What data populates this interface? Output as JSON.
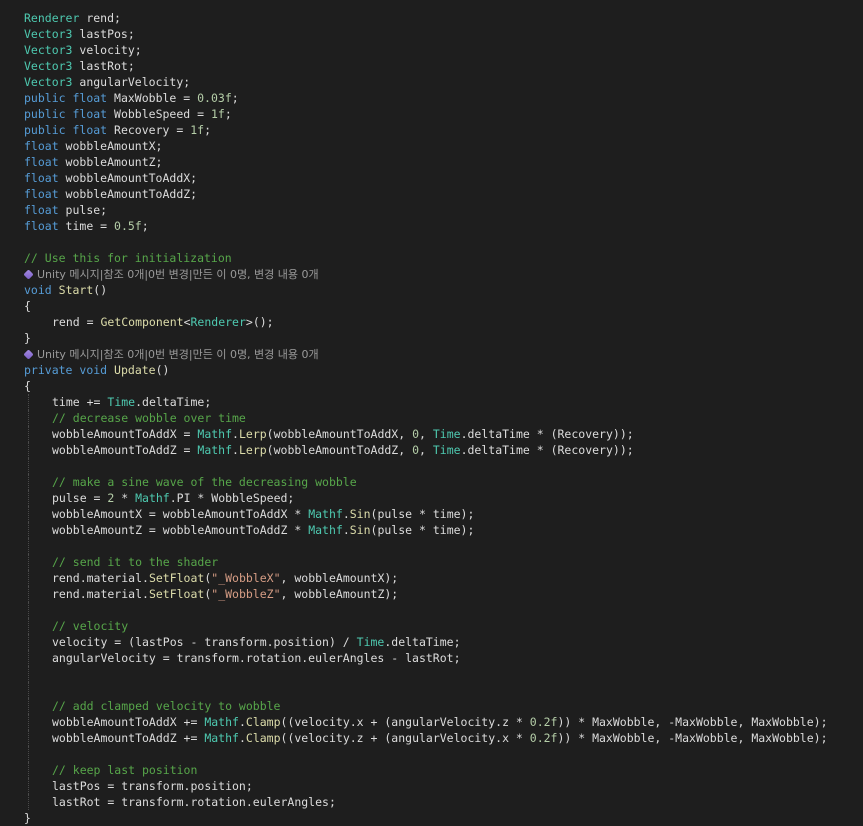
{
  "editor": {
    "lines": [
      {
        "indent": 0,
        "tokens": [
          {
            "t": "Renderer",
            "c": "ty"
          },
          {
            "t": " rend;",
            "c": "pl"
          }
        ]
      },
      {
        "indent": 0,
        "tokens": [
          {
            "t": "Vector3",
            "c": "ty"
          },
          {
            "t": " lastPos;",
            "c": "pl"
          }
        ]
      },
      {
        "indent": 0,
        "tokens": [
          {
            "t": "Vector3",
            "c": "ty"
          },
          {
            "t": " velocity;",
            "c": "pl"
          }
        ]
      },
      {
        "indent": 0,
        "tokens": [
          {
            "t": "Vector3",
            "c": "ty"
          },
          {
            "t": " lastRot;",
            "c": "pl"
          }
        ]
      },
      {
        "indent": 0,
        "tokens": [
          {
            "t": "Vector3",
            "c": "ty"
          },
          {
            "t": " angularVelocity;",
            "c": "pl"
          }
        ]
      },
      {
        "indent": 0,
        "tokens": [
          {
            "t": "public",
            "c": "kw"
          },
          {
            "t": " ",
            "c": "pl"
          },
          {
            "t": "float",
            "c": "kw"
          },
          {
            "t": " MaxWobble = ",
            "c": "pl"
          },
          {
            "t": "0.03f",
            "c": "nu"
          },
          {
            "t": ";",
            "c": "pl"
          }
        ]
      },
      {
        "indent": 0,
        "tokens": [
          {
            "t": "public",
            "c": "kw"
          },
          {
            "t": " ",
            "c": "pl"
          },
          {
            "t": "float",
            "c": "kw"
          },
          {
            "t": " WobbleSpeed = ",
            "c": "pl"
          },
          {
            "t": "1f",
            "c": "nu"
          },
          {
            "t": ";",
            "c": "pl"
          }
        ]
      },
      {
        "indent": 0,
        "tokens": [
          {
            "t": "public",
            "c": "kw"
          },
          {
            "t": " ",
            "c": "pl"
          },
          {
            "t": "float",
            "c": "kw"
          },
          {
            "t": " Recovery = ",
            "c": "pl"
          },
          {
            "t": "1f",
            "c": "nu"
          },
          {
            "t": ";",
            "c": "pl"
          }
        ]
      },
      {
        "indent": 0,
        "tokens": [
          {
            "t": "float",
            "c": "kw"
          },
          {
            "t": " wobbleAmountX;",
            "c": "pl"
          }
        ]
      },
      {
        "indent": 0,
        "tokens": [
          {
            "t": "float",
            "c": "kw"
          },
          {
            "t": " wobbleAmountZ;",
            "c": "pl"
          }
        ]
      },
      {
        "indent": 0,
        "tokens": [
          {
            "t": "float",
            "c": "kw"
          },
          {
            "t": " wobbleAmountToAddX;",
            "c": "pl"
          }
        ]
      },
      {
        "indent": 0,
        "tokens": [
          {
            "t": "float",
            "c": "kw"
          },
          {
            "t": " wobbleAmountToAddZ;",
            "c": "pl"
          }
        ]
      },
      {
        "indent": 0,
        "tokens": [
          {
            "t": "float",
            "c": "kw"
          },
          {
            "t": " pulse;",
            "c": "pl"
          }
        ]
      },
      {
        "indent": 0,
        "tokens": [
          {
            "t": "float",
            "c": "kw"
          },
          {
            "t": " time = ",
            "c": "pl"
          },
          {
            "t": "0.5f",
            "c": "nu"
          },
          {
            "t": ";",
            "c": "pl"
          }
        ]
      },
      {
        "indent": 0,
        "tokens": []
      },
      {
        "indent": 0,
        "tokens": [
          {
            "t": "// Use this for initialization",
            "c": "cm"
          }
        ]
      },
      {
        "indent": 0,
        "lens": "Unity 메시지|참조 0개|0번 변경|만든 이 0명, 변경 내용 0개"
      },
      {
        "indent": 0,
        "tokens": [
          {
            "t": "void",
            "c": "kw"
          },
          {
            "t": " ",
            "c": "pl"
          },
          {
            "t": "Start",
            "c": "fn"
          },
          {
            "t": "()",
            "c": "pl"
          }
        ]
      },
      {
        "indent": 0,
        "tokens": [
          {
            "t": "{",
            "c": "pl"
          }
        ]
      },
      {
        "indent": 1,
        "noguide": true,
        "tokens": [
          {
            "t": "rend = ",
            "c": "pl"
          },
          {
            "t": "GetComponent",
            "c": "fn"
          },
          {
            "t": "<",
            "c": "pl"
          },
          {
            "t": "Renderer",
            "c": "ty"
          },
          {
            "t": ">();",
            "c": "pl"
          }
        ]
      },
      {
        "indent": 0,
        "tokens": [
          {
            "t": "}",
            "c": "pl"
          }
        ]
      },
      {
        "indent": 0,
        "lens": "Unity 메시지|참조 0개|0번 변경|만든 이 0명, 변경 내용 0개"
      },
      {
        "indent": 0,
        "tokens": [
          {
            "t": "private",
            "c": "kw"
          },
          {
            "t": " ",
            "c": "pl"
          },
          {
            "t": "void",
            "c": "kw"
          },
          {
            "t": " ",
            "c": "pl"
          },
          {
            "t": "Update",
            "c": "fn"
          },
          {
            "t": "()",
            "c": "pl"
          }
        ]
      },
      {
        "indent": 0,
        "tokens": [
          {
            "t": "{",
            "c": "pl"
          }
        ]
      },
      {
        "indent": 1,
        "tokens": [
          {
            "t": "time += ",
            "c": "pl"
          },
          {
            "t": "Time",
            "c": "ty"
          },
          {
            "t": ".deltaTime;",
            "c": "pl"
          }
        ]
      },
      {
        "indent": 1,
        "tokens": [
          {
            "t": "// decrease wobble over time",
            "c": "cm"
          }
        ]
      },
      {
        "indent": 1,
        "tokens": [
          {
            "t": "wobbleAmountToAddX = ",
            "c": "pl"
          },
          {
            "t": "Mathf",
            "c": "ty"
          },
          {
            "t": ".",
            "c": "pl"
          },
          {
            "t": "Lerp",
            "c": "fn"
          },
          {
            "t": "(wobbleAmountToAddX, ",
            "c": "pl"
          },
          {
            "t": "0",
            "c": "nu"
          },
          {
            "t": ", ",
            "c": "pl"
          },
          {
            "t": "Time",
            "c": "ty"
          },
          {
            "t": ".deltaTime * (Recovery));",
            "c": "pl"
          }
        ]
      },
      {
        "indent": 1,
        "tokens": [
          {
            "t": "wobbleAmountToAddZ = ",
            "c": "pl"
          },
          {
            "t": "Mathf",
            "c": "ty"
          },
          {
            "t": ".",
            "c": "pl"
          },
          {
            "t": "Lerp",
            "c": "fn"
          },
          {
            "t": "(wobbleAmountToAddZ, ",
            "c": "pl"
          },
          {
            "t": "0",
            "c": "nu"
          },
          {
            "t": ", ",
            "c": "pl"
          },
          {
            "t": "Time",
            "c": "ty"
          },
          {
            "t": ".deltaTime * (Recovery));",
            "c": "pl"
          }
        ]
      },
      {
        "indent": 1,
        "tokens": []
      },
      {
        "indent": 1,
        "tokens": [
          {
            "t": "// make a sine wave of the decreasing wobble",
            "c": "cm"
          }
        ]
      },
      {
        "indent": 1,
        "tokens": [
          {
            "t": "pulse = ",
            "c": "pl"
          },
          {
            "t": "2",
            "c": "nu"
          },
          {
            "t": " * ",
            "c": "pl"
          },
          {
            "t": "Mathf",
            "c": "ty"
          },
          {
            "t": ".PI * WobbleSpeed;",
            "c": "pl"
          }
        ]
      },
      {
        "indent": 1,
        "tokens": [
          {
            "t": "wobbleAmountX = wobbleAmountToAddX * ",
            "c": "pl"
          },
          {
            "t": "Mathf",
            "c": "ty"
          },
          {
            "t": ".",
            "c": "pl"
          },
          {
            "t": "Sin",
            "c": "fn"
          },
          {
            "t": "(pulse * time);",
            "c": "pl"
          }
        ]
      },
      {
        "indent": 1,
        "tokens": [
          {
            "t": "wobbleAmountZ = wobbleAmountToAddZ * ",
            "c": "pl"
          },
          {
            "t": "Mathf",
            "c": "ty"
          },
          {
            "t": ".",
            "c": "pl"
          },
          {
            "t": "Sin",
            "c": "fn"
          },
          {
            "t": "(pulse * time);",
            "c": "pl"
          }
        ]
      },
      {
        "indent": 1,
        "tokens": []
      },
      {
        "indent": 1,
        "tokens": [
          {
            "t": "// send it to the shader",
            "c": "cm"
          }
        ]
      },
      {
        "indent": 1,
        "tokens": [
          {
            "t": "rend.material.",
            "c": "pl"
          },
          {
            "t": "SetFloat",
            "c": "fn"
          },
          {
            "t": "(",
            "c": "pl"
          },
          {
            "t": "\"_WobbleX\"",
            "c": "st"
          },
          {
            "t": ", wobbleAmountX);",
            "c": "pl"
          }
        ]
      },
      {
        "indent": 1,
        "tokens": [
          {
            "t": "rend.material.",
            "c": "pl"
          },
          {
            "t": "SetFloat",
            "c": "fn"
          },
          {
            "t": "(",
            "c": "pl"
          },
          {
            "t": "\"_WobbleZ\"",
            "c": "st"
          },
          {
            "t": ", wobbleAmountZ);",
            "c": "pl"
          }
        ]
      },
      {
        "indent": 1,
        "tokens": []
      },
      {
        "indent": 1,
        "tokens": [
          {
            "t": "// velocity",
            "c": "cm"
          }
        ]
      },
      {
        "indent": 1,
        "tokens": [
          {
            "t": "velocity = (lastPos - transform.position) / ",
            "c": "pl"
          },
          {
            "t": "Time",
            "c": "ty"
          },
          {
            "t": ".deltaTime;",
            "c": "pl"
          }
        ]
      },
      {
        "indent": 1,
        "tokens": [
          {
            "t": "angularVelocity = transform.rotation.eulerAngles - lastRot;",
            "c": "pl"
          }
        ]
      },
      {
        "indent": 1,
        "tokens": []
      },
      {
        "indent": 1,
        "tokens": []
      },
      {
        "indent": 1,
        "tokens": [
          {
            "t": "// add clamped velocity to wobble",
            "c": "cm"
          }
        ]
      },
      {
        "indent": 1,
        "tokens": [
          {
            "t": "wobbleAmountToAddX += ",
            "c": "pl"
          },
          {
            "t": "Mathf",
            "c": "ty"
          },
          {
            "t": ".",
            "c": "pl"
          },
          {
            "t": "Clamp",
            "c": "fn"
          },
          {
            "t": "((velocity.x + (angularVelocity.z * ",
            "c": "pl"
          },
          {
            "t": "0.2f",
            "c": "nu"
          },
          {
            "t": ")) * MaxWobble, -MaxWobble, MaxWobble);",
            "c": "pl"
          }
        ]
      },
      {
        "indent": 1,
        "tokens": [
          {
            "t": "wobbleAmountToAddZ += ",
            "c": "pl"
          },
          {
            "t": "Mathf",
            "c": "ty"
          },
          {
            "t": ".",
            "c": "pl"
          },
          {
            "t": "Clamp",
            "c": "fn"
          },
          {
            "t": "((velocity.z + (angularVelocity.x * ",
            "c": "pl"
          },
          {
            "t": "0.2f",
            "c": "nu"
          },
          {
            "t": ")) * MaxWobble, -MaxWobble, MaxWobble);",
            "c": "pl"
          }
        ]
      },
      {
        "indent": 1,
        "tokens": []
      },
      {
        "indent": 1,
        "tokens": [
          {
            "t": "// keep last position",
            "c": "cm"
          }
        ]
      },
      {
        "indent": 1,
        "tokens": [
          {
            "t": "lastPos = transform.position;",
            "c": "pl"
          }
        ]
      },
      {
        "indent": 1,
        "tokens": [
          {
            "t": "lastRot = transform.rotation.eulerAngles;",
            "c": "pl"
          }
        ]
      },
      {
        "indent": 0,
        "tokens": [
          {
            "t": "}",
            "c": "pl"
          }
        ]
      }
    ]
  }
}
